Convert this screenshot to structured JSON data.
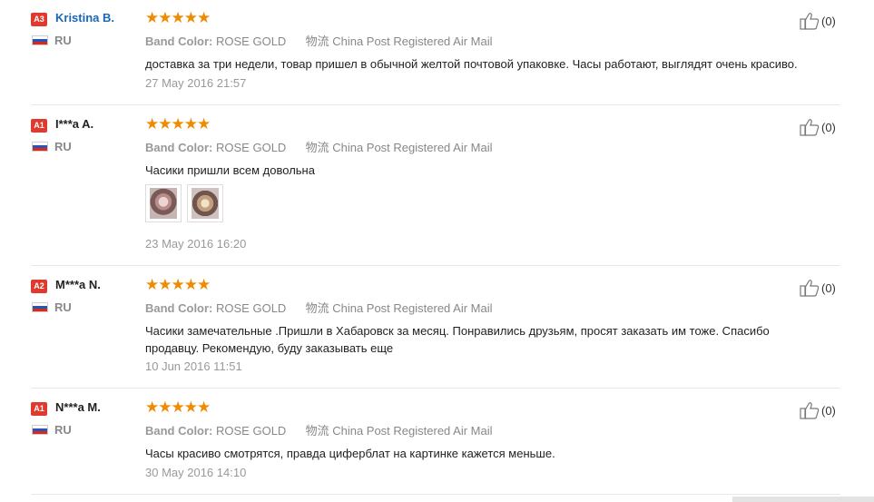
{
  "common": {
    "band_label": "Band Color:",
    "band_value": "ROSE GOLD",
    "logistics_label": "物流",
    "logistics_value": "China Post Registered Air Mail",
    "stars": "★★★★★",
    "rating": 5
  },
  "reviews": [
    {
      "level": "A3",
      "name": "Kristina B.",
      "country": "RU",
      "helpful_count": "(0)",
      "text": "доставка за три недели, товар пришел в обычной желтой почтовой упаковке. Часы работают, выглядят очень красиво.",
      "date": "27 May 2016 21:57"
    },
    {
      "level": "A1",
      "name": "I***a A.",
      "country": "RU",
      "helpful_count": "(0)",
      "text": "Часики пришли всем довольна",
      "date": "23 May 2016 16:20",
      "photo_count": 2
    },
    {
      "level": "A2",
      "name": "M***a N.",
      "country": "RU",
      "helpful_count": "(0)",
      "text": "Часики замечательные .Пришли в Хабаровск за месяц. Понравились друзьям, просят заказать им тоже. Спасибо продавцу. Рекомендую, буду заказывать еще",
      "date": "10 Jun 2016 11:51"
    },
    {
      "level": "A1",
      "name": "N***a M.",
      "country": "RU",
      "helpful_count": "(0)",
      "text": "Часы красиво смотрятся, правда циферблат на картинке кажется меньше.",
      "date": "30 May 2016 14:10"
    }
  ],
  "colors": {
    "level_badge": "#e03a2e",
    "star": "#f08a00",
    "link_name": "#1a66b8"
  },
  "icons": {
    "flag": "russia-flag-icon",
    "helpful": "thumbs-up-icon"
  }
}
